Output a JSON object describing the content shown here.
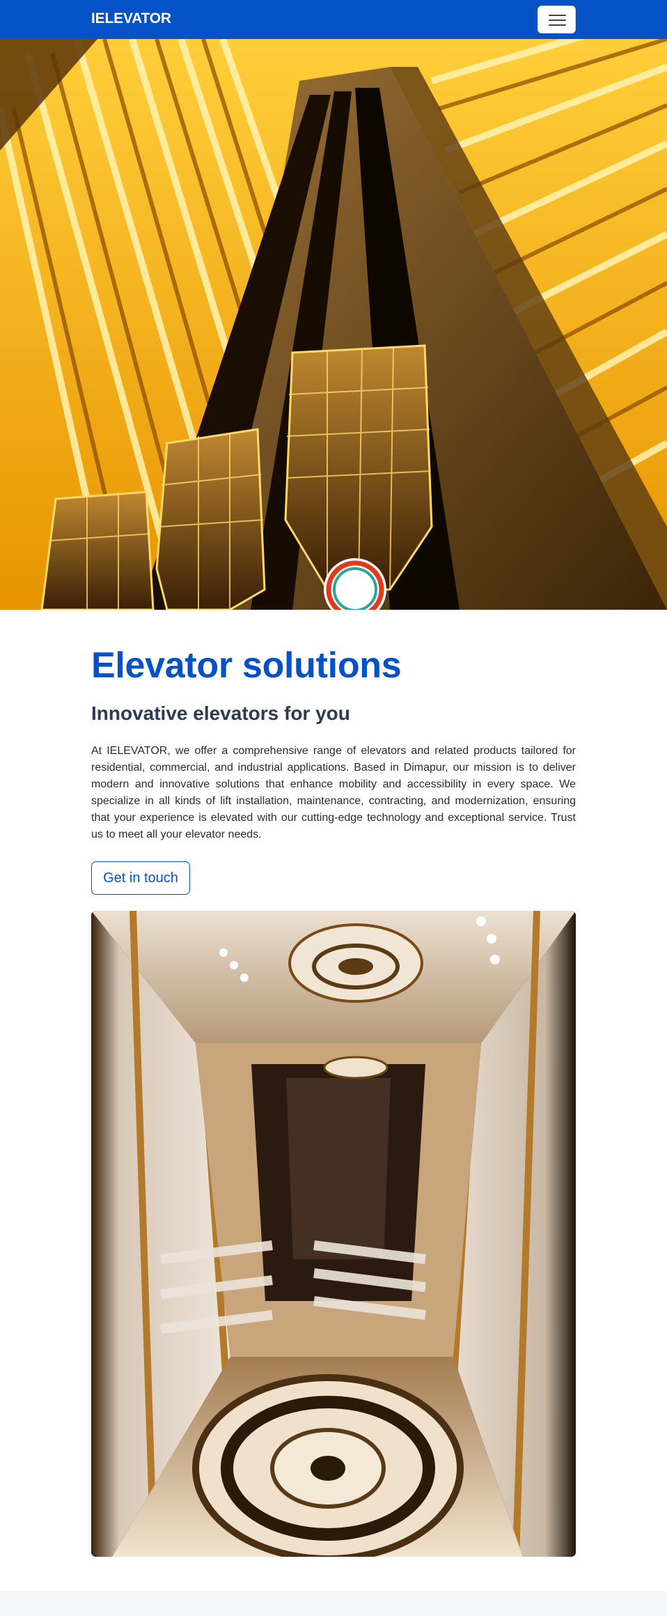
{
  "navbar": {
    "brand": "IELEVATOR",
    "menu_icon": "hamburger-menu-icon",
    "bg_color": "#0452c6"
  },
  "hero": {
    "image": "elevator-atrium-photo"
  },
  "main": {
    "title": "Elevator solutions",
    "subtitle": "Innovative elevators for you",
    "description": "At IELEVATOR, we offer a comprehensive range of elevators and related products tailored for residential, commercial, and industrial applications. Based in Dimapur, our mission is to deliver modern and innovative solutions that enhance mobility and accessibility in every space. We specialize in all kinds of lift installation, maintenance, contracting, and modernization, ensuring that your experience is elevated with our cutting-edge technology and exceptional service. Trust us to meet all your elevator needs.",
    "cta_label": "Get in touch",
    "accent_color": "#0452c6",
    "cabin_image": "elevator-cabin-interior-photo"
  }
}
